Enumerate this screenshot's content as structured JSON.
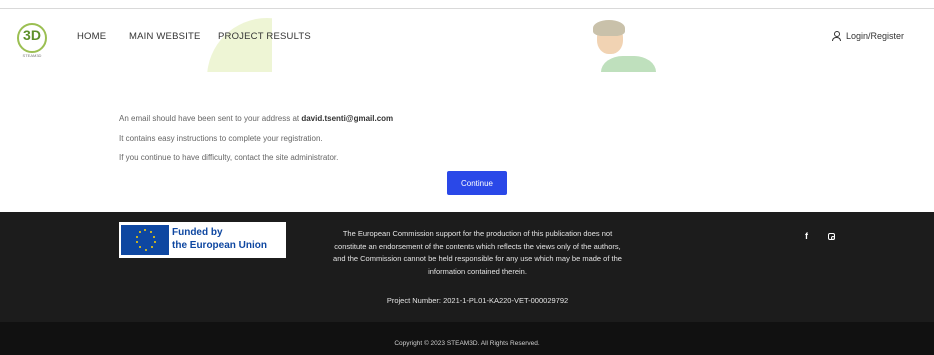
{
  "header": {
    "logo_text": "3D",
    "logo_sub": "STEAM3D",
    "nav": [
      "HOME",
      "MAIN WEBSITE",
      "PROJECT RESULTS"
    ],
    "login_label": "Login/Register"
  },
  "main": {
    "line1_prefix": "An email should have been sent to your address at ",
    "email": "david.tsenti@gmail.com",
    "line2": "It contains easy instructions to complete your registration.",
    "line3": "If you continue to have difficulty, contact the site administrator.",
    "continue_label": "Continue"
  },
  "footer": {
    "eu_line1": "Funded by",
    "eu_line2": "the European Union",
    "disclaimer": [
      "The European Commission support for the production of this publication does not",
      "constitute an endorsement of the contents which reflects the views only of the authors,",
      "and the Commission cannot be held responsible for any use which may be made of the",
      "information contained therein."
    ],
    "project_number": "Project Number: 2021-1-PL01-KA220-VET-000029792",
    "social": {
      "facebook": "f"
    },
    "copyright": "Copyright © 2023 STEAM3D. All Rights Reserved."
  },
  "colors": {
    "accent_button": "#2a48e8",
    "footer_bg": "#1c1c1c",
    "eu_blue": "#0e47a1",
    "eu_star": "#ffd400"
  },
  "icons": [
    "user-icon",
    "facebook-icon",
    "instagram-icon",
    "eu-flag-icon"
  ]
}
